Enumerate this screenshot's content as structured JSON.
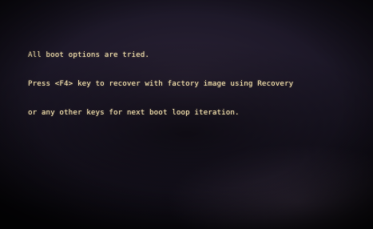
{
  "screen": {
    "text_color": "#ead9a8",
    "background_color": "#1d1828",
    "lines": [
      "All boot options are tried.",
      "Press <F4> key to recover with factory image using Recovery",
      "or any other keys for next boot loop iteration."
    ]
  }
}
